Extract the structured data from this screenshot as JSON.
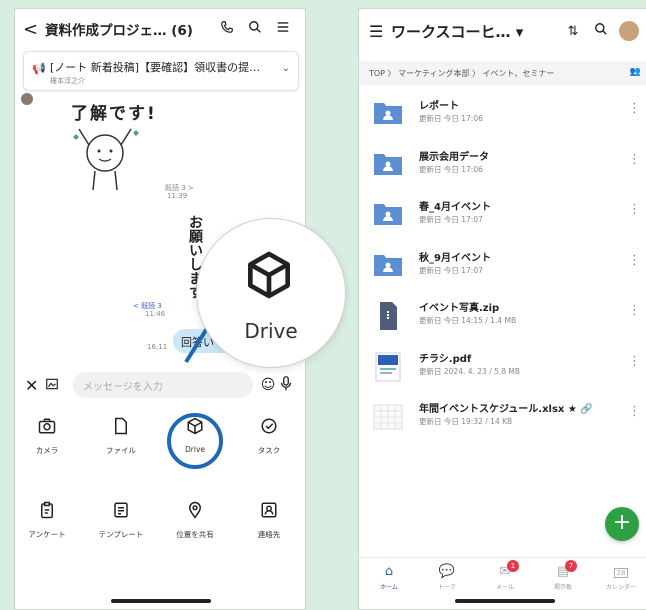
{
  "left": {
    "header": {
      "back": "<",
      "title": "資料作成プロジェ… (6)"
    },
    "notice": {
      "title": "[ノート 新着投稿]【要確認】領収書の提…",
      "author": "榎本淳之介"
    },
    "sticker_text": "了解です!",
    "read1": "既読 3 >",
    "time1": "11:39",
    "vertical_message": "お願いします",
    "vertical_message2": "よ",
    "read2": "< 既読 3",
    "time2": "11:46",
    "bubble_text": "回答い",
    "time3": "16:11",
    "input_placeholder": "メッセージを入力",
    "magnified_label": "Drive",
    "grid_items": [
      {
        "label": "カメラ"
      },
      {
        "label": "ファイル"
      },
      {
        "label": "Drive"
      },
      {
        "label": "タスク"
      },
      {
        "label": "アンケート"
      },
      {
        "label": "テンプレート"
      },
      {
        "label": "位置を共有"
      },
      {
        "label": "連絡先"
      }
    ]
  },
  "right": {
    "header": {
      "title": "ワークスコーヒ… ▾"
    },
    "breadcrumb": "TOP 〉 マーケティング本部 〉 イベント、セミナー",
    "files": [
      {
        "name": "レポート",
        "meta": "更新日 今日 17:06",
        "kind": "folder"
      },
      {
        "name": "展示会用データ",
        "meta": "更新日 今日 17:06",
        "kind": "folder"
      },
      {
        "name": "春_4月イベント",
        "meta": "更新日 今日 17:07",
        "kind": "folder"
      },
      {
        "name": "秋_9月イベント",
        "meta": "更新日 今日 17:07",
        "kind": "folder"
      },
      {
        "name": "イベント写真.zip",
        "meta": "更新日 今日 14:15 / 1.4 MB",
        "kind": "zip"
      },
      {
        "name": "チラシ.pdf",
        "meta": "更新日 2024. 4. 23 / 5.8 MB",
        "kind": "pdf"
      },
      {
        "name": "年間イベントスケジュール.xlsx ★ 🔗",
        "meta": "更新日 今日 19:32 / 14 KB",
        "kind": "xlsx"
      }
    ],
    "tabs": [
      {
        "label": "ホーム",
        "badge": ""
      },
      {
        "label": "トーク",
        "badge": ""
      },
      {
        "label": "メール",
        "badge": "1"
      },
      {
        "label": "掲示板",
        "badge": "7"
      },
      {
        "label": "カレンダー",
        "badge": ""
      }
    ],
    "calendar_day": "28"
  },
  "colors": {
    "accent": "#1f67b8",
    "folder": "#5b8fd1",
    "fab": "#2ea043",
    "badge": "#e5384a",
    "background": "#d9eee1"
  }
}
